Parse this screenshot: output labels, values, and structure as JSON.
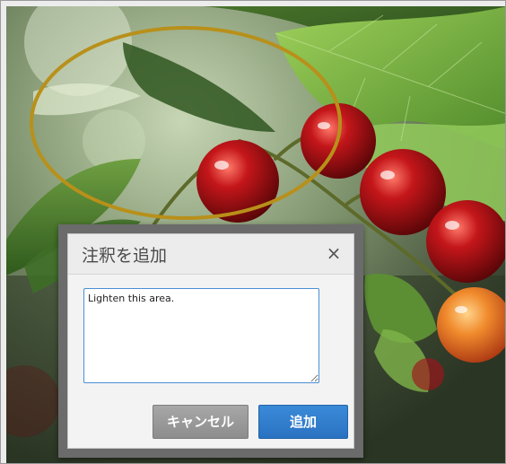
{
  "dialog": {
    "title": "注釈を追加",
    "close_glyph": "×",
    "note_text": "Lighten this area.",
    "cancel_label": "キャンセル",
    "add_label": "追加"
  },
  "annotation": {
    "ellipse_color": "#b8901a"
  },
  "colors": {
    "dialog_bg": "#f3f3f3",
    "overlay_border": "#6b6b6b",
    "input_focus": "#4a8fd6",
    "primary_button": "#2a72c2",
    "secondary_button": "#8d8d8d"
  },
  "icons": {
    "close": "close-icon",
    "resize": "resize-handle-icon"
  }
}
